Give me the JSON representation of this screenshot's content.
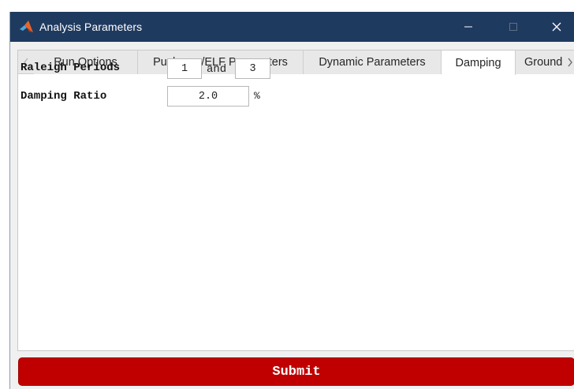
{
  "window": {
    "title": "Analysis Parameters",
    "controls": {
      "minimize": "—",
      "maximize": "□",
      "close": "✕"
    }
  },
  "tabs": [
    {
      "label": "Run Options",
      "active": false
    },
    {
      "label": "Pushover/ELF Parameters",
      "active": false
    },
    {
      "label": "Dynamic Parameters",
      "active": false
    },
    {
      "label": "Damping",
      "active": true
    },
    {
      "label": "Ground",
      "active": false
    }
  ],
  "tab_scroll": {
    "left_icon": "chevron-left-icon",
    "right_icon": "chevron-right-icon"
  },
  "damping": {
    "raleigh_label": "Raleigh Periods",
    "period_1": "1",
    "and_text": "and",
    "period_2": "3",
    "ratio_label": "Damping Ratio",
    "ratio_value": "2.0",
    "ratio_unit": "%"
  },
  "submit_label": "Submit",
  "colors": {
    "titlebar": "#1f3a5f",
    "submit": "#c00000",
    "tab_active": "#ffffff",
    "tab_inactive": "#e8e8e8"
  }
}
